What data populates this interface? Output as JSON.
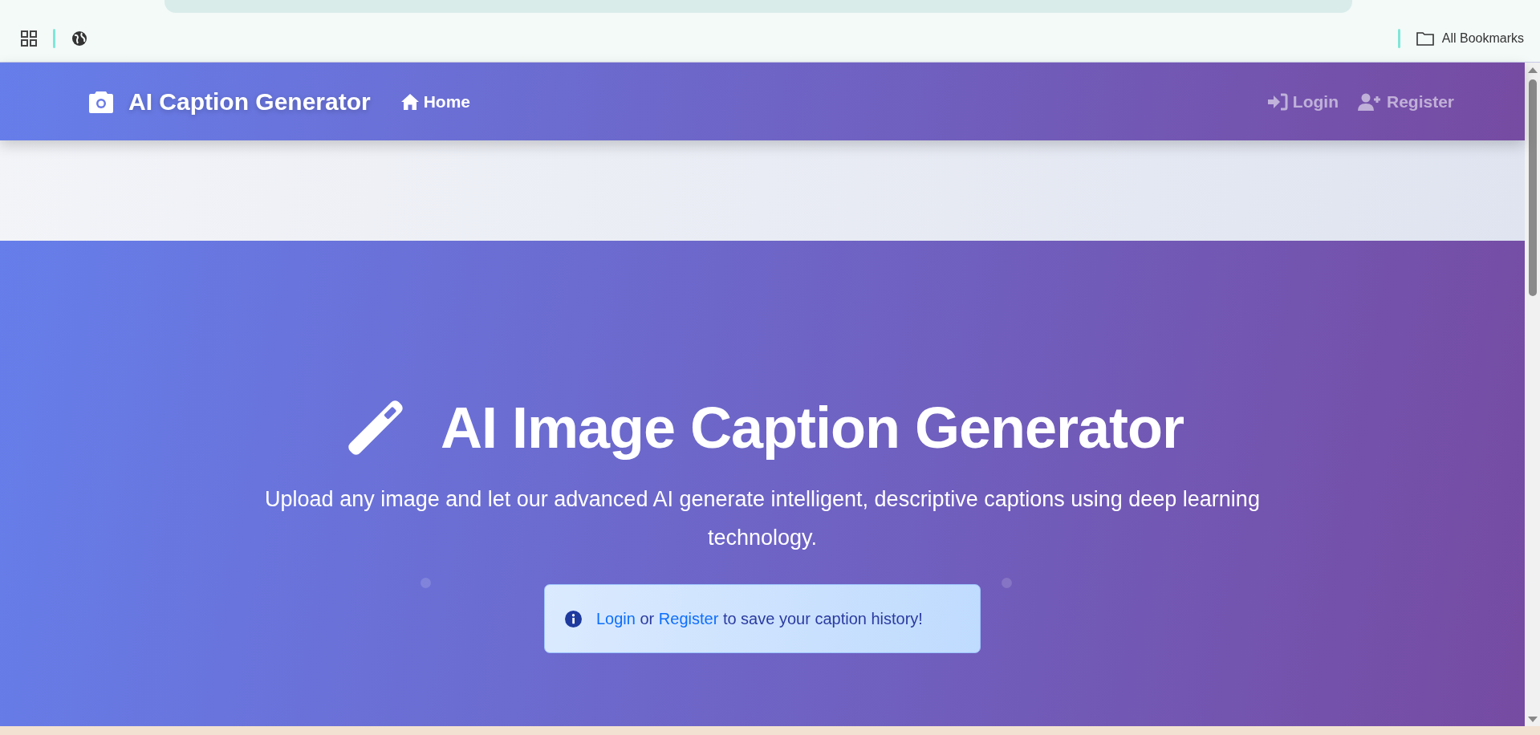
{
  "bookmarks_bar": {
    "label": "All Bookmarks"
  },
  "navbar": {
    "brand": "AI Caption Generator",
    "links": [
      {
        "kind": "home",
        "label": "Home"
      }
    ],
    "auth_links": [
      {
        "kind": "login",
        "label": "Login"
      },
      {
        "kind": "register",
        "label": "Register"
      }
    ]
  },
  "hero": {
    "title": "AI Image Caption Generator",
    "subtitle": "Upload any image and let our advanced AI generate intelligent, descriptive captions using deep learning technology.",
    "notice": [
      {
        "kind": "link",
        "text": "Login"
      },
      {
        "kind": "text",
        "text": " or "
      },
      {
        "kind": "link",
        "text": "Register"
      },
      {
        "kind": "text",
        "text": " to save your caption history!"
      }
    ]
  }
}
